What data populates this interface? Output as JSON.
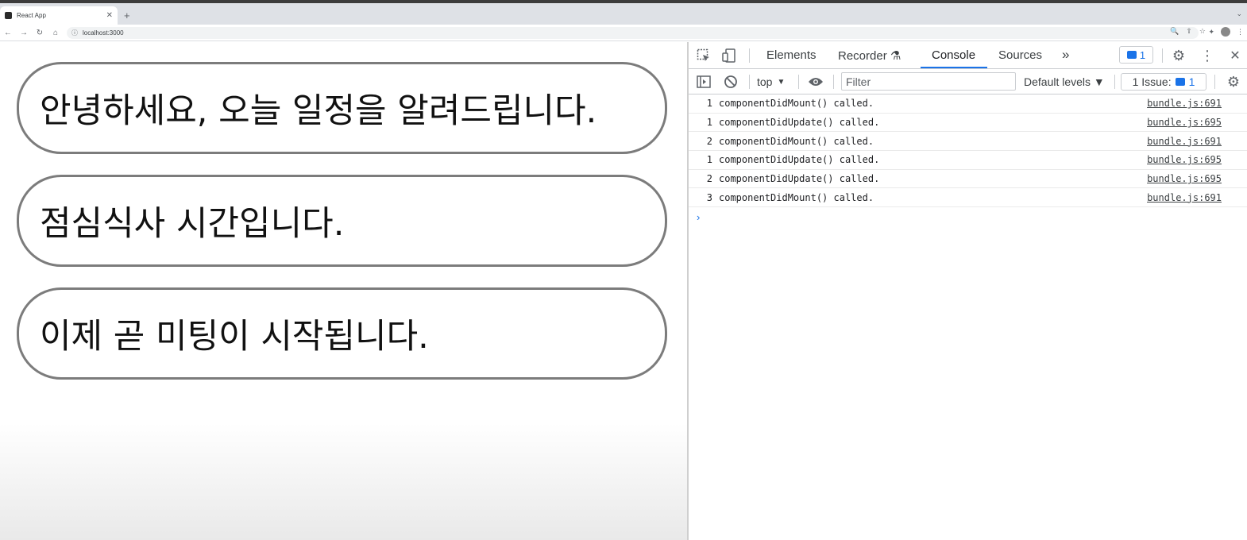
{
  "browser": {
    "tab_title": "React App",
    "tab_close": "✕",
    "new_tab": "+",
    "tab_menu": "⌄",
    "nav": {
      "back": "←",
      "forward": "→",
      "reload": "↻",
      "home": "⌂"
    },
    "url": "localhost:3000",
    "url_info": "ⓘ",
    "omni_icons": [
      "🔍",
      "⇪",
      "☆"
    ],
    "ext_icons": [
      "✦",
      "⋮"
    ]
  },
  "app": {
    "notifications": [
      "안녕하세요, 오늘 일정을 알려드립니다.",
      "점심식사 시간입니다.",
      "이제 곧 미팅이 시작됩니다."
    ]
  },
  "devtools": {
    "tabs": {
      "elements": "Elements",
      "recorder": "Recorder",
      "recorder_icon": "⚗",
      "console": "Console",
      "sources": "Sources",
      "more": "»"
    },
    "badge_count": "1",
    "close": "✕",
    "context": "top",
    "filter_placeholder": "Filter",
    "levels": "Default levels ▼",
    "issues_label": "1 Issue:",
    "issues_count": "1",
    "logs": [
      {
        "count": "1",
        "message": "componentDidMount() called.",
        "source": "bundle.js:691"
      },
      {
        "count": "1",
        "message": "componentDidUpdate() called.",
        "source": "bundle.js:695"
      },
      {
        "count": "2",
        "message": "componentDidMount() called.",
        "source": "bundle.js:691"
      },
      {
        "count": "1",
        "message": "componentDidUpdate() called.",
        "source": "bundle.js:695"
      },
      {
        "count": "2",
        "message": "componentDidUpdate() called.",
        "source": "bundle.js:695"
      },
      {
        "count": "3",
        "message": "componentDidMount() called.",
        "source": "bundle.js:691"
      }
    ],
    "prompt": "›"
  }
}
